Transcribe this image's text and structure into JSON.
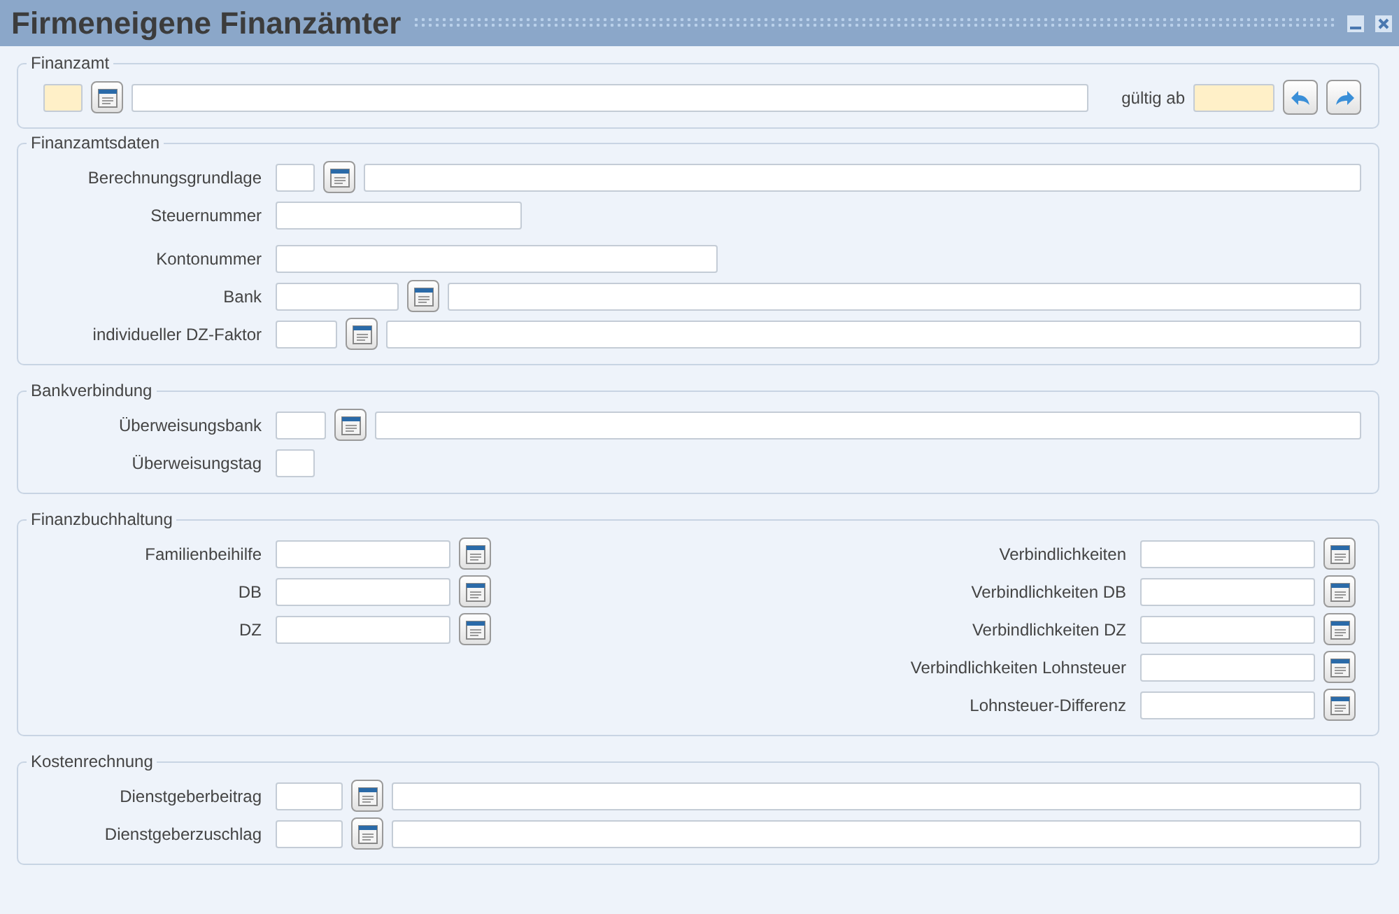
{
  "window": {
    "title": "Firmeneigene Finanzämter"
  },
  "sections": [
    {
      "title": "Finanzamt",
      "rows": [
        {
          "label": "",
          "fields": [
            {
              "kind": "code",
              "required": true
            },
            {
              "kind": "lookup"
            },
            {
              "kind": "desc",
              "required": false
            },
            {
              "kind": "caption",
              "text": "gültig ab"
            },
            {
              "kind": "date",
              "required": true
            },
            {
              "kind": "back"
            },
            {
              "kind": "forward"
            }
          ]
        }
      ]
    },
    {
      "title": "Finanzamtsdaten",
      "rows": [
        {
          "label": "Berechnungsgrundlage",
          "fields": [
            {
              "kind": "code"
            },
            {
              "kind": "lookup"
            },
            {
              "kind": "desc"
            }
          ]
        },
        {
          "label": "Steuernummer",
          "fields": [
            {
              "kind": "tax"
            }
          ]
        },
        {
          "label": "Kontonummer",
          "fields": [
            {
              "kind": "account"
            }
          ]
        },
        {
          "label": "Bank",
          "fields": [
            {
              "kind": "mid"
            },
            {
              "kind": "lookup"
            },
            {
              "kind": "desc"
            }
          ]
        },
        {
          "label": "individueller DZ-Faktor",
          "fields": [
            {
              "kind": "short"
            },
            {
              "kind": "lookup"
            },
            {
              "kind": "desc"
            }
          ]
        }
      ]
    },
    {
      "title": "Bankverbindung",
      "rows": [
        {
          "label": "Überweisungsbank",
          "fields": [
            {
              "kind": "key"
            },
            {
              "kind": "lookup"
            },
            {
              "kind": "desc"
            }
          ]
        },
        {
          "label": "Überweisungstag",
          "fields": [
            {
              "kind": "code"
            }
          ]
        }
      ]
    },
    {
      "title": "Finanzbuchhaltung",
      "columns": [
        [
          {
            "label": "Familienbeihilfe",
            "fields": [
              {
                "kind": "amount"
              },
              {
                "kind": "lookup"
              }
            ]
          },
          {
            "label": "DB",
            "fields": [
              {
                "kind": "amount"
              },
              {
                "kind": "lookup"
              }
            ]
          },
          {
            "label": "DZ",
            "fields": [
              {
                "kind": "amount"
              },
              {
                "kind": "lookup"
              }
            ]
          }
        ],
        [
          {
            "label": "Verbindlichkeiten",
            "fields": [
              {
                "kind": "amount"
              },
              {
                "kind": "lookup"
              }
            ]
          },
          {
            "label": "Verbindlichkeiten DB",
            "fields": [
              {
                "kind": "amount"
              },
              {
                "kind": "lookup"
              }
            ]
          },
          {
            "label": "Verbindlichkeiten DZ",
            "fields": [
              {
                "kind": "amount"
              },
              {
                "kind": "lookup"
              }
            ]
          },
          {
            "label": "Verbindlichkeiten Lohnsteuer",
            "fields": [
              {
                "kind": "amount"
              },
              {
                "kind": "lookup"
              }
            ]
          },
          {
            "label": "Lohnsteuer-Differenz",
            "fields": [
              {
                "kind": "amount"
              },
              {
                "kind": "lookup"
              }
            ]
          }
        ]
      ]
    },
    {
      "title": "Kostenrechnung",
      "rows": [
        {
          "label": "Dienstgeberbeitrag",
          "fields": [
            {
              "kind": "wide"
            },
            {
              "kind": "lookup"
            },
            {
              "kind": "desc"
            }
          ]
        },
        {
          "label": "Dienstgeberzuschlag",
          "fields": [
            {
              "kind": "wide"
            },
            {
              "kind": "lookup"
            },
            {
              "kind": "desc"
            }
          ]
        }
      ]
    }
  ]
}
